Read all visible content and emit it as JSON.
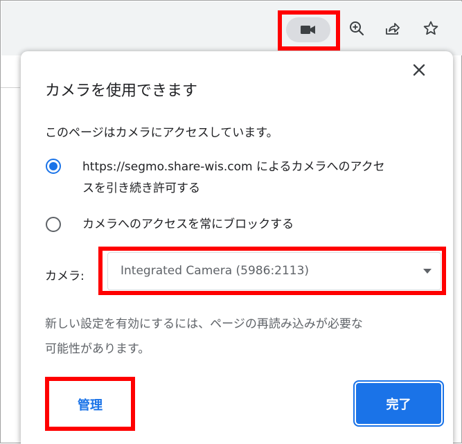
{
  "toolbar": {
    "icons": [
      "camera-icon",
      "zoom-icon",
      "share-icon",
      "bookmark-star-icon"
    ]
  },
  "popup": {
    "title": "カメラを使用できます",
    "description": "このページはカメラにアクセスしています。",
    "options": [
      {
        "label_line1": "https://segmo.share-wis.com によるカメラへのアクセ",
        "label_line2": "スを引き続き許可する",
        "selected": true
      },
      {
        "label_line1": "カメラへのアクセスを常にブロックする",
        "selected": false
      }
    ],
    "camera_label": "カメラ:",
    "camera_select_value": "Integrated Camera (5986:2113)",
    "notice_line1": "新しい設定を有効にするには、ページの再読み込みが必要な",
    "notice_line2": "可能性があります。",
    "manage_label": "管理",
    "done_label": "完了"
  },
  "colors": {
    "accent": "#1a73e8",
    "highlight": "#ff0000",
    "toolbar_bg": "#f1f3f4"
  }
}
